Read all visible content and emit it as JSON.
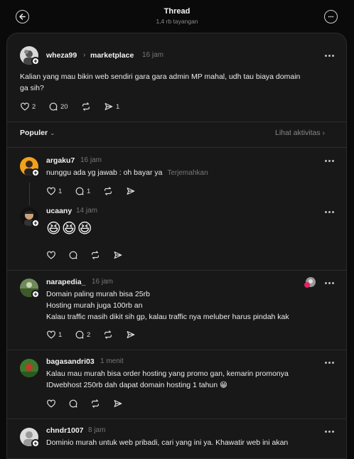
{
  "header": {
    "title": "Thread",
    "views": "1,4 rb tayangan"
  },
  "post": {
    "username": "wheza99",
    "community": "marketplace",
    "time": "16 jam",
    "text_line1": "Kalian yang mau bikin web sendiri gara gara admin MP mahal, udh tau biaya domain",
    "text_line2": "ga sih?",
    "likes": "2",
    "comments": "20",
    "shares": "1"
  },
  "sort": {
    "label": "Populer",
    "activity_label": "Lihat aktivitas"
  },
  "replies": [
    {
      "username": "argaku7",
      "time": "16 jam",
      "text": "nunggu ada yg jawab : oh bayar ya",
      "translate": "Terjemahkan",
      "likes": "1",
      "comments": "1"
    },
    {
      "username": "ucaany",
      "time": "14 jam",
      "emoji": "😆😆😆"
    },
    {
      "username": "narapedia_",
      "time": "16 jam",
      "line1": "Domain paling murah bisa 25rb",
      "line2": "Hosting murah juga 100rb an",
      "line3": "Kalau traffic masih dikit sih gp, kalau traffic nya meluber harus pindah kak",
      "likes": "1",
      "comments": "2"
    },
    {
      "username": "bagasandri03",
      "time": "1 menit",
      "line1": "Kalau mau murah bisa order hosting yang promo gan, kemarin promonya",
      "line2": "IDwebhost 250rb dah dapat domain hosting 1 tahun 😁"
    },
    {
      "username": "chndr1007",
      "time": "8 jam",
      "line1": "Dominio murah untuk web pribadi, cari yang ini ya. Khawatir web ini akan"
    }
  ],
  "colors": {
    "background": "#0a0a0a",
    "panel": "#181818",
    "divider": "#2c2c2c",
    "muted": "#777777",
    "accent_heart": "#e0245e"
  }
}
